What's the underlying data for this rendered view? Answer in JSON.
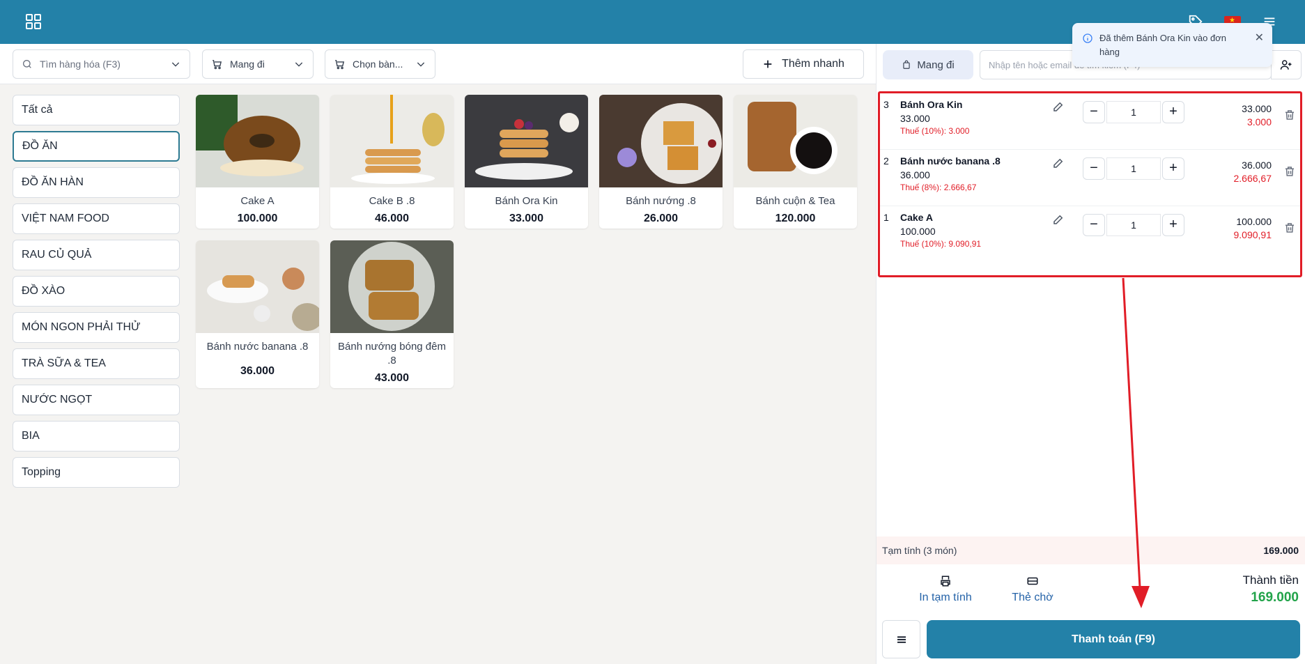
{
  "toolbar": {
    "search_placeholder": "Tìm hàng hóa (F3)",
    "order_type": "Mang đi",
    "table_select": "Chọn bàn...",
    "quick_add": "Thêm nhanh"
  },
  "categories": [
    {
      "label": "Tất cả"
    },
    {
      "label": "ĐỒ ĂN"
    },
    {
      "label": "ĐỒ ĂN HÀN"
    },
    {
      "label": "VIỆT NAM FOOD"
    },
    {
      "label": "RAU CỦ QUẢ"
    },
    {
      "label": "ĐỒ XÀO"
    },
    {
      "label": "MÓN NGON PHẢI THỬ"
    },
    {
      "label": "TRÀ SỮA & TEA"
    },
    {
      "label": "NƯỚC NGỌT"
    },
    {
      "label": "BIA"
    },
    {
      "label": "Topping"
    }
  ],
  "active_category": "ĐỒ ĂN",
  "products": [
    {
      "name": "Cake A",
      "price": "100.000"
    },
    {
      "name": "Cake B .8",
      "price": "46.000"
    },
    {
      "name": "Bánh Ora Kin",
      "price": "33.000"
    },
    {
      "name": "Bánh nướng .8",
      "price": "26.000"
    },
    {
      "name": "Bánh cuộn & Tea",
      "price": "120.000"
    },
    {
      "name": "Bánh nước banana .8",
      "price": "36.000"
    },
    {
      "name": "Bánh nướng bóng đêm .8",
      "price": "43.000"
    }
  ],
  "order_panel": {
    "order_type_pill": "Mang đi",
    "customer_placeholder": "Nhập tên hoặc email để tìm kiếm (F4)",
    "items": [
      {
        "index": "3",
        "name": "Bánh Ora Kin",
        "price": "33.000",
        "tax": "Thuế (10%): 3.000",
        "qty": "1",
        "total": "33.000",
        "total_tax": "3.000"
      },
      {
        "index": "2",
        "name": "Bánh nước banana .8",
        "price": "36.000",
        "tax": "Thuế (8%): 2.666,67",
        "qty": "1",
        "total": "36.000",
        "total_tax": "2.666,67"
      },
      {
        "index": "1",
        "name": "Cake A",
        "price": "100.000",
        "tax": "Thuế (10%): 9.090,91",
        "qty": "1",
        "total": "100.000",
        "total_tax": "9.090,91"
      }
    ],
    "subtotal_label": "Tạm tính (3 món)",
    "subtotal_value": "169.000",
    "print_label": "In tạm tính",
    "wait_label": "Thẻ chờ",
    "total_label": "Thành tiền",
    "total_value": "169.000",
    "pay_button": "Thanh toán (F9)"
  },
  "toast": {
    "message": "Đã thêm Bánh Ora Kin vào đơn hàng"
  },
  "colors": {
    "brand": "#2381a8",
    "danger": "#e11d27",
    "success": "#22a34a"
  }
}
